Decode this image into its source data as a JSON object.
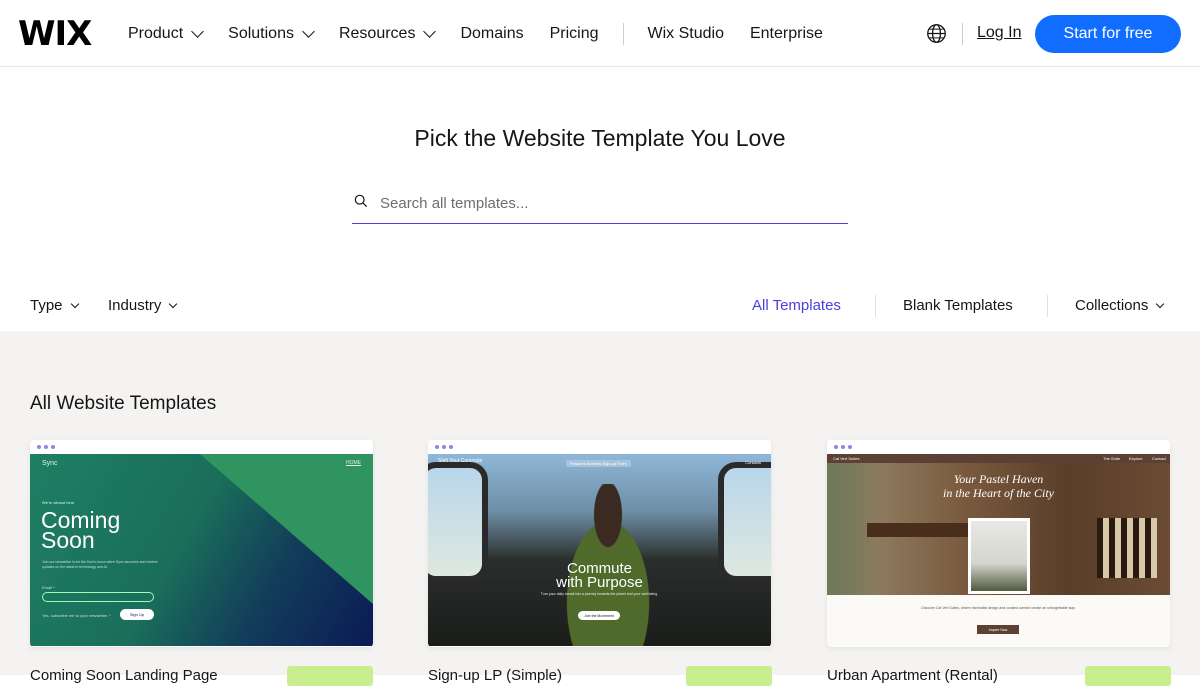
{
  "header": {
    "logo": "WIX",
    "nav": [
      {
        "label": "Product",
        "dropdown": true
      },
      {
        "label": "Solutions",
        "dropdown": true
      },
      {
        "label": "Resources",
        "dropdown": true
      },
      {
        "label": "Domains",
        "dropdown": false
      },
      {
        "label": "Pricing",
        "dropdown": false
      }
    ],
    "nav_secondary": [
      {
        "label": "Wix Studio"
      },
      {
        "label": "Enterprise"
      }
    ],
    "language_icon": "globe-icon",
    "login_label": "Log In",
    "cta_label": "Start for free",
    "cta_color": "#116dff"
  },
  "hero": {
    "title": "Pick the Website Template You Love",
    "search_placeholder": "Search all templates...",
    "search_icon": "search-icon",
    "search_value": ""
  },
  "filters": {
    "left": [
      {
        "label": "Type"
      },
      {
        "label": "Industry"
      }
    ],
    "right": [
      {
        "label": "All Templates",
        "active": true
      },
      {
        "label": "Blank Templates",
        "active": false
      },
      {
        "label": "Collections",
        "dropdown": true
      }
    ],
    "active_color": "#4c3fdb"
  },
  "gallery": {
    "title": "All Website Templates",
    "cards": [
      {
        "name": "Coming Soon Landing Page",
        "preview": {
          "brand": "Sync",
          "home": "HOME",
          "kicker": "We're almost here",
          "headline_line1": "Coming",
          "headline_line2": "Soon",
          "body": "Join our newsletter to be the first to know when Sync launches and receive updates on the latest in technology and AI.",
          "email_label": "Email *",
          "checkbox_label": "Yes, subscribe me to your newsletter. *",
          "button": "Sign Up"
        }
      },
      {
        "name": "Sign-up LP (Simple)",
        "preview": {
          "brand": "Shift Your Commute",
          "menu": "Features   Benefits   Sign-up Form",
          "contact": "Contacts",
          "headline_line1": "Commute",
          "headline_line2": "with Purpose",
          "body": "Turn your daily transit into a journey towards the planet and your well-being.",
          "button": "Join the Movement"
        }
      },
      {
        "name": "Urban Apartment (Rental)",
        "preview": {
          "brand": "Cal Vert Suites",
          "menu_1": "The Suite",
          "menu_2": "Explore",
          "menu_3": "Contact",
          "headline_line1": "Your Pastel Haven",
          "headline_line2": "in the Heart of the City",
          "body": "Discover Cal Vert Suites, where minimalist design and curated comfort create an unforgettable stay.",
          "button": "Inquire Now"
        }
      }
    ]
  }
}
